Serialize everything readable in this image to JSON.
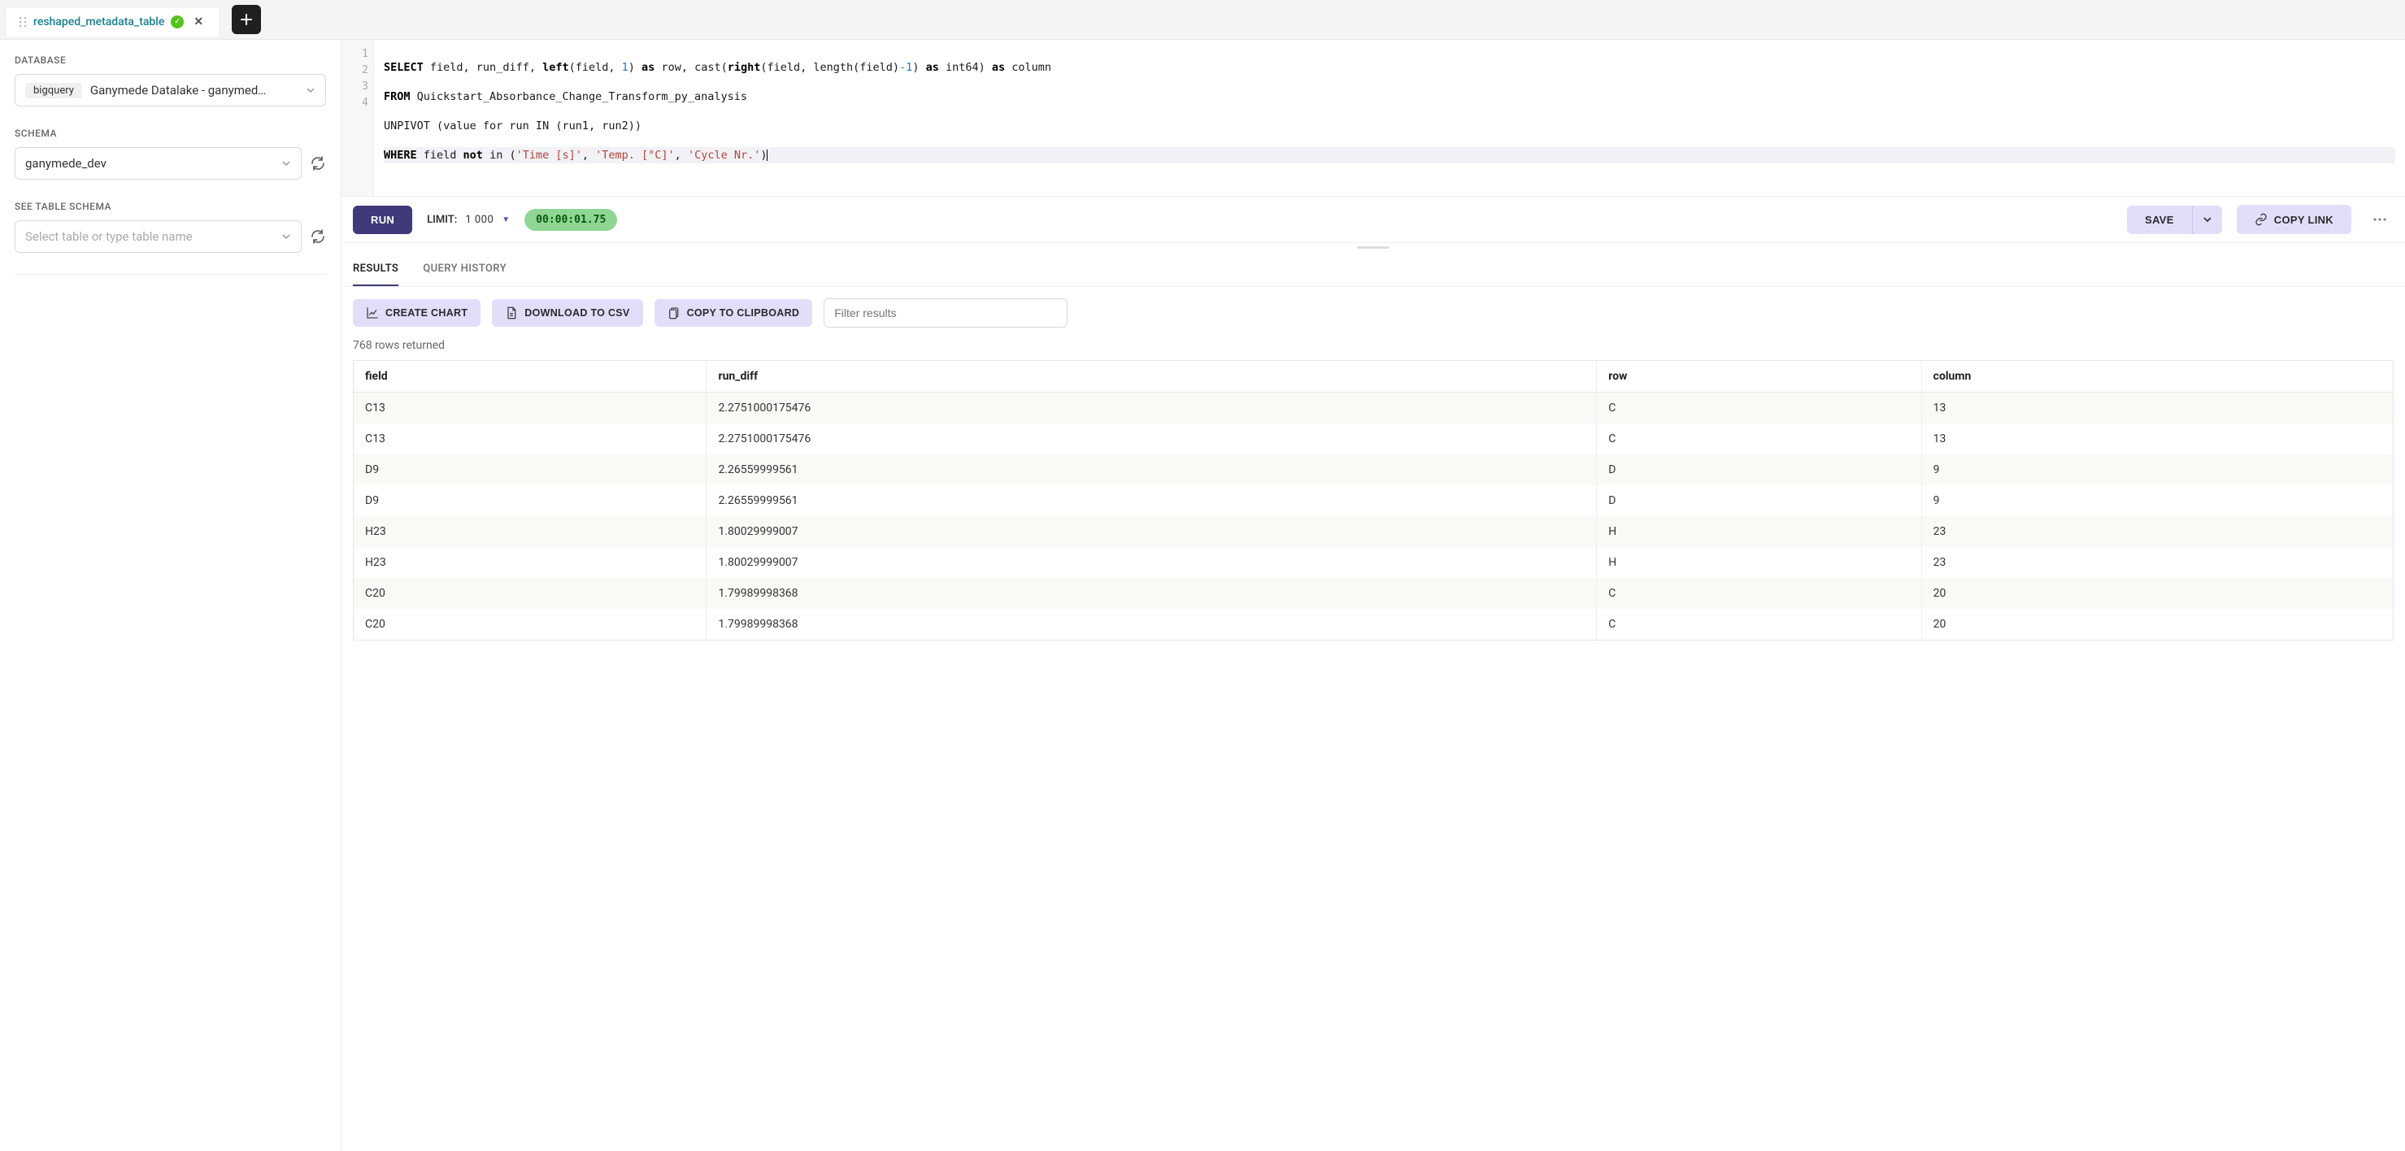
{
  "tab": {
    "label": "reshaped_metadata_table"
  },
  "sidebar": {
    "database_label": "DATABASE",
    "database_chip": "bigquery",
    "database_value": "Ganymede Datalake - ganymed…",
    "schema_label": "SCHEMA",
    "schema_value": "ganymede_dev",
    "table_label": "SEE TABLE SCHEMA",
    "table_placeholder": "Select table or type table name"
  },
  "code": {
    "line1_parts": [
      "SELECT",
      " field, run_diff, ",
      "left",
      "(field, ",
      "1",
      ") ",
      "as",
      " row, cast(",
      "right",
      "(field, length(field)",
      "-1",
      ") ",
      "as",
      " int64) ",
      "as",
      " column"
    ],
    "line2_parts": [
      "FROM",
      " Quickstart_Absorbance_Change_Transform_py_analysis"
    ],
    "line3_parts": [
      "UNPIVOT (value for run IN (run1, run2))"
    ],
    "line4_parts": [
      "WHERE",
      " field ",
      "not",
      " in (",
      "'Time [s]'",
      ", ",
      "'Temp. [°C]'",
      ", ",
      "'Cycle Nr.'",
      ")"
    ]
  },
  "toolbar": {
    "run": "RUN",
    "limit_label": "LIMIT:",
    "limit_value": "1 000",
    "timer": "00:00:01.75",
    "save": "SAVE",
    "copy_link": "COPY LINK"
  },
  "resultTabs": {
    "results": "RESULTS",
    "history": "QUERY HISTORY"
  },
  "resultBar": {
    "create_chart": "CREATE CHART",
    "download_csv": "DOWNLOAD TO CSV",
    "copy_clip": "COPY TO CLIPBOARD",
    "filter_placeholder": "Filter results"
  },
  "rows_returned": "768 rows returned",
  "table": {
    "headers": [
      "field",
      "run_diff",
      "row",
      "column"
    ],
    "rows": [
      [
        "C13",
        "2.2751000175476",
        "C",
        "13"
      ],
      [
        "C13",
        "2.2751000175476",
        "C",
        "13"
      ],
      [
        "D9",
        "2.26559999561",
        "D",
        "9"
      ],
      [
        "D9",
        "2.26559999561",
        "D",
        "9"
      ],
      [
        "H23",
        "1.80029999007",
        "H",
        "23"
      ],
      [
        "H23",
        "1.80029999007",
        "H",
        "23"
      ],
      [
        "C20",
        "1.79989998368",
        "C",
        "20"
      ],
      [
        "C20",
        "1.79989998368",
        "C",
        "20"
      ]
    ]
  }
}
